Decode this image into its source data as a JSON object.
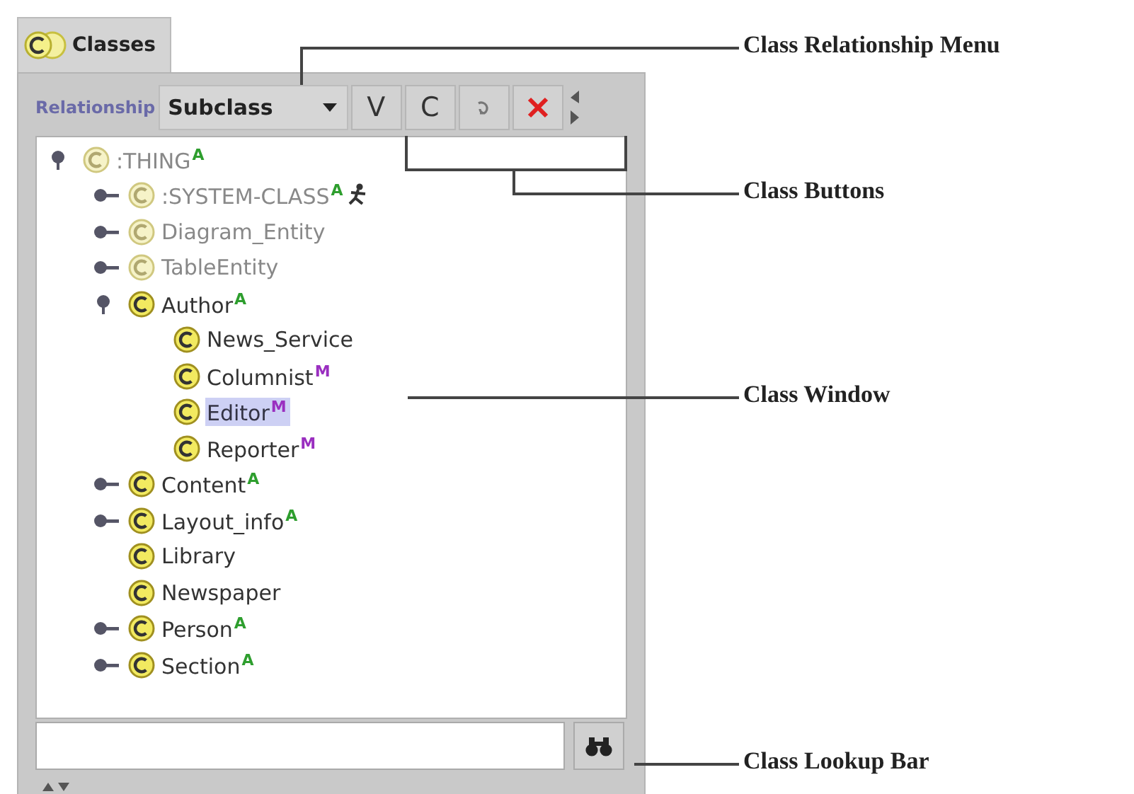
{
  "tab": {
    "label": "Classes",
    "selected": true
  },
  "toolbar": {
    "relationship_label": "Relationship",
    "relationship_value": "Subclass",
    "buttons": [
      {
        "kind": "text",
        "label": "V"
      },
      {
        "kind": "text",
        "label": "C"
      },
      {
        "kind": "glyph"
      },
      {
        "kind": "delete"
      }
    ]
  },
  "tree": [
    {
      "name": ":THING",
      "system": true,
      "expanded": true,
      "selected": false,
      "badge": {
        "text": "A",
        "color": "#2e9e2e"
      },
      "children": [
        {
          "name": ":SYSTEM-CLASS",
          "system": true,
          "expanded": false,
          "selected": false,
          "badge": {
            "text": "A",
            "color": "#2e9e2e"
          },
          "flagged": true
        },
        {
          "name": "Diagram_Entity",
          "system": true,
          "expanded": false,
          "selected": false
        },
        {
          "name": "TableEntity",
          "system": true,
          "expanded": false,
          "selected": false
        },
        {
          "name": "Author",
          "system": false,
          "expanded": true,
          "selected": false,
          "badge": {
            "text": "A",
            "color": "#2e9e2e"
          },
          "children": [
            {
              "name": "News_Service",
              "system": false,
              "selected": false
            },
            {
              "name": "Columnist",
              "system": false,
              "selected": false,
              "badge": {
                "text": "M",
                "color": "#9a2fc0"
              }
            },
            {
              "name": "Editor",
              "system": false,
              "selected": true,
              "badge": {
                "text": "M",
                "color": "#9a2fc0"
              }
            },
            {
              "name": "Reporter",
              "system": false,
              "selected": false,
              "badge": {
                "text": "M",
                "color": "#9a2fc0"
              }
            }
          ]
        },
        {
          "name": "Content",
          "system": false,
          "expanded": false,
          "selected": false,
          "badge": {
            "text": "A",
            "color": "#2e9e2e"
          }
        },
        {
          "name": "Layout_info",
          "system": false,
          "expanded": false,
          "selected": false,
          "badge": {
            "text": "A",
            "color": "#2e9e2e"
          }
        },
        {
          "name": "Library",
          "system": false,
          "selected": false
        },
        {
          "name": "Newspaper",
          "system": false,
          "selected": false
        },
        {
          "name": "Person",
          "system": false,
          "expanded": false,
          "selected": false,
          "badge": {
            "text": "A",
            "color": "#2e9e2e"
          }
        },
        {
          "name": "Section",
          "system": false,
          "expanded": false,
          "selected": false,
          "badge": {
            "text": "A",
            "color": "#2e9e2e"
          }
        }
      ]
    }
  ],
  "callouts": [
    {
      "kind": "menu",
      "label": "Class Relationship Menu"
    },
    {
      "kind": "buttons",
      "label": "Class Buttons"
    },
    {
      "kind": "window",
      "label": "Class Window"
    },
    {
      "kind": "lookup",
      "label": "Class Lookup Bar"
    }
  ]
}
